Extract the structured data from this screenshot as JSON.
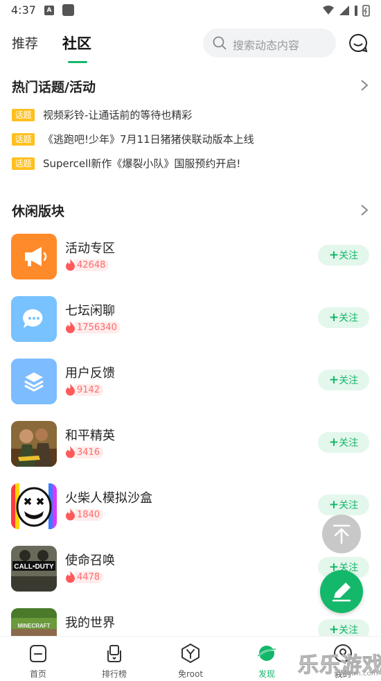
{
  "status_bar": {
    "time": "4:37",
    "notif_letter": "A"
  },
  "top_nav": {
    "tabs": [
      {
        "label": "推荐",
        "active": false
      },
      {
        "label": "社区",
        "active": true
      }
    ],
    "search_placeholder": "搜索动态内容"
  },
  "hot_topics": {
    "title": "热门话题/活动",
    "badge": "话题",
    "items": [
      {
        "text": "视频彩铃-让通话前的等待也精彩"
      },
      {
        "text": "《逃跑吧!少年》7月11日猪猪侠联动版本上线"
      },
      {
        "text": "Supercell新作《爆裂小队》国服预约开启!"
      }
    ]
  },
  "leisure": {
    "title": "休闲版块",
    "follow_label": "关注",
    "follow_plus": "+",
    "forums": [
      {
        "name": "活动专区",
        "heat": "42648",
        "icon": "megaphone-icon"
      },
      {
        "name": "七坛闲聊",
        "heat": "1756340",
        "icon": "chat-bubble-icon"
      },
      {
        "name": "用户反馈",
        "heat": "9142",
        "icon": "layers-icon"
      },
      {
        "name": "和平精英",
        "heat": "3416",
        "icon": "game-cover-peace-elite"
      },
      {
        "name": "火柴人模拟沙盒",
        "heat": "1840",
        "icon": "game-cover-stickman"
      },
      {
        "name": "使命召唤",
        "heat": "4478",
        "icon": "game-cover-call-of-duty"
      },
      {
        "name": "我的世界",
        "heat": "",
        "icon": "game-cover-minecraft"
      }
    ],
    "game_cover_text": {
      "cod": "CALL•DUTY",
      "minecraft": "MINECRAFT"
    }
  },
  "bottom_nav": {
    "items": [
      {
        "label": "首页",
        "icon": "home-icon",
        "active": false
      },
      {
        "label": "排行榜",
        "icon": "ranking-icon",
        "active": false
      },
      {
        "label": "免root",
        "icon": "no-root-icon",
        "active": false
      },
      {
        "label": "发现",
        "icon": "planet-icon",
        "active": true
      },
      {
        "label": "我的",
        "icon": "profile-icon",
        "active": false
      }
    ]
  },
  "watermark": {
    "text": "乐乐游戏",
    "sub": "yxdown.com"
  },
  "colors": {
    "accent": "#12b76a",
    "badge": "#ffc01e",
    "heat": "#ff6b6b"
  }
}
